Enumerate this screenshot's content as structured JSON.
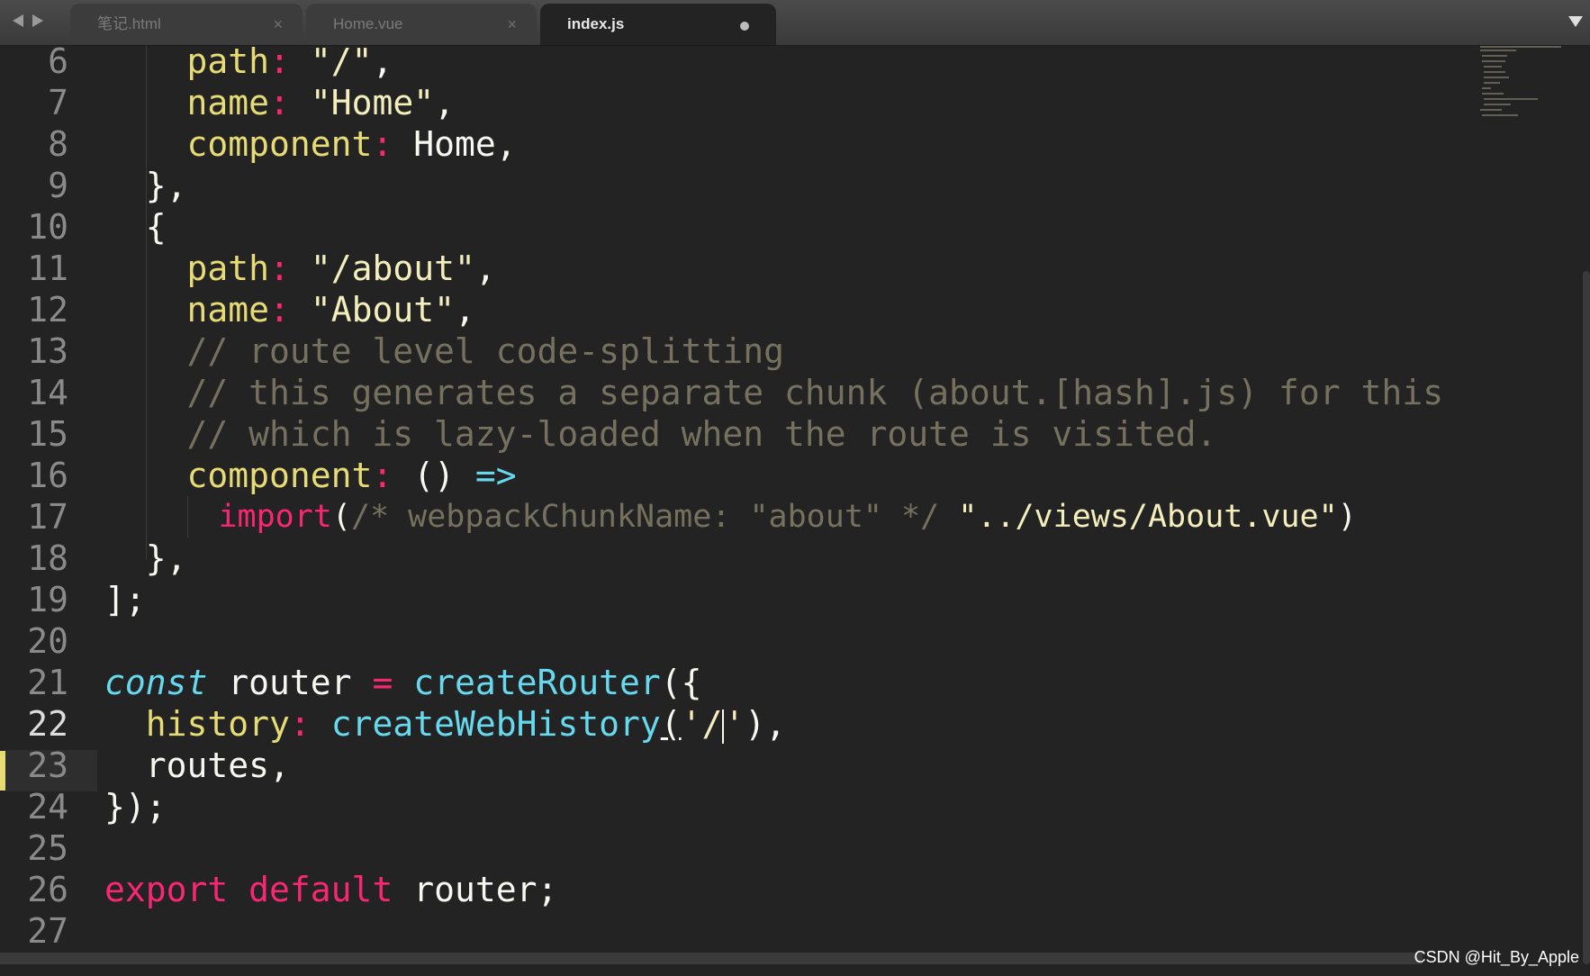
{
  "tabs": [
    {
      "label": "笔记.html",
      "state": "inactive"
    },
    {
      "label": "Home.vue",
      "state": "inactive"
    },
    {
      "label": "index.js",
      "state": "active-modified"
    }
  ],
  "tab_close_glyph": "×",
  "line_numbers": [
    "6",
    "7",
    "8",
    "9",
    "10",
    "11",
    "12",
    "13",
    "14",
    "15",
    "16",
    "17",
    "18",
    "19",
    "20",
    "21",
    "22",
    "23",
    "24",
    "25",
    "26",
    "27"
  ],
  "current_line": "22",
  "code": {
    "l6": {
      "prop": "path",
      "colon": ":",
      "str": "\"/\"",
      "end": ","
    },
    "l7": {
      "prop": "name",
      "colon": ":",
      "str": "\"Home\"",
      "end": ","
    },
    "l8": {
      "prop": "component",
      "colon": ":",
      "ident": "Home",
      "end": ","
    },
    "l9": {
      "text": "},"
    },
    "l10": {
      "text": "{"
    },
    "l11": {
      "prop": "path",
      "colon": ":",
      "str": "\"/about\"",
      "end": ","
    },
    "l12": {
      "prop": "name",
      "colon": ":",
      "str": "\"About\"",
      "end": ","
    },
    "l13": {
      "comment": "// route level code-splitting"
    },
    "l14": {
      "comment": "// this generates a separate chunk (about.[hash].js) for this"
    },
    "l15": {
      "comment": "// which is lazy-loaded when the route is visited."
    },
    "l16": {
      "prop": "component",
      "colon": ":",
      "parens": "()",
      "arrow": "=>"
    },
    "l17": {
      "keyword": "import",
      "open": "(",
      "comment": "/* webpackChunkName: \"about\" */",
      "str": "\"../views/About.vue\"",
      "close": ")"
    },
    "l18": {
      "text": "},"
    },
    "l19": {
      "text": "];"
    },
    "l21": {
      "storage": "const",
      "ident": "router",
      "op": "=",
      "func": "createRouter",
      "end": "({"
    },
    "l22": {
      "prop": "history",
      "colon": ":",
      "func": "createWebHistory",
      "open": "(",
      "str_start": "'/",
      "str_end": "'",
      "close": "),"
    },
    "l23": {
      "text": "routes,"
    },
    "l24": {
      "text": "});"
    },
    "l26": {
      "kw1": "export",
      "kw2": "default",
      "ident": "router",
      "end": ";"
    }
  },
  "watermark": "CSDN @Hit_By_Apple",
  "colors": {
    "background": "#232323",
    "property": "#e6db74",
    "string": "#f4eebd",
    "keyword": "#f92672",
    "function": "#66d9ef",
    "comment": "#75715e"
  }
}
